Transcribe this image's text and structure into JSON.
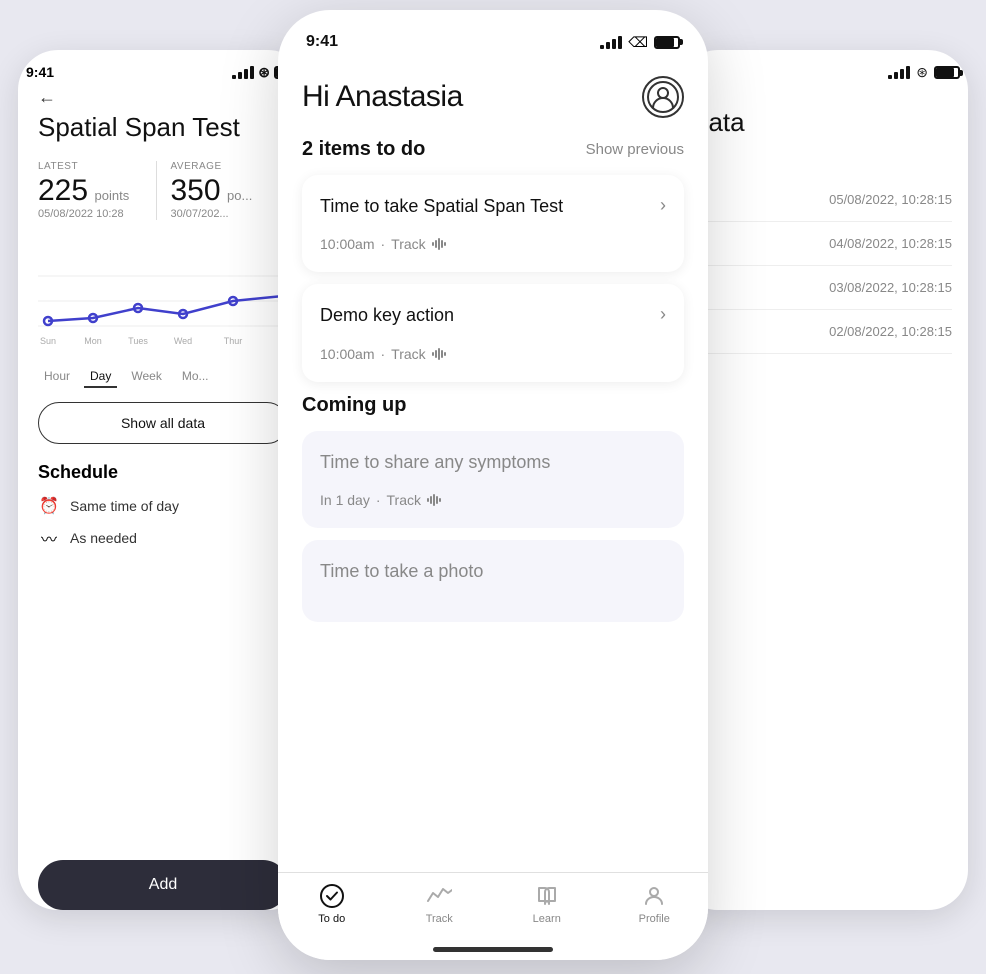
{
  "backLeftPhone": {
    "statusTime": "9:41",
    "backArrow": "←",
    "pageTitle": "Spatial Span Test",
    "stats": {
      "latest": {
        "label": "LATEST",
        "value": "225",
        "unit": "points",
        "date": "05/08/2022 10:28"
      },
      "average": {
        "label": "AVERAGE",
        "value": "350",
        "unit": "po...",
        "date": "30/07/202..."
      }
    },
    "chartDays": [
      "Sun",
      "Mon",
      "Tues",
      "Wed",
      "Thur"
    ],
    "timeTabs": [
      "Hour",
      "Day",
      "Week",
      "Mo..."
    ],
    "activeTab": "Day",
    "showDataBtn": "Show all data",
    "schedule": {
      "title": "Schedule",
      "items": [
        {
          "icon": "⏰",
          "text": "Same time of day"
        },
        {
          "icon": "〰",
          "text": "As needed"
        }
      ]
    },
    "addBtn": "Add"
  },
  "frontPhone": {
    "statusTime": "9:41",
    "greeting": "Hi Anastasia",
    "todoCount": "2 items to do",
    "showPrevious": "Show previous",
    "todoItems": [
      {
        "title": "Time to take Spatial Span Test",
        "time": "10:00am",
        "category": "Track",
        "hasChevron": true
      },
      {
        "title": "Demo key action",
        "time": "10:00am",
        "category": "Track",
        "hasChevron": true
      }
    ],
    "comingUpTitle": "Coming up",
    "comingUpItems": [
      {
        "title": "Time to share any symptoms",
        "time": "In 1 day",
        "category": "Track"
      },
      {
        "title": "Time to take a photo",
        "time": "",
        "category": ""
      }
    ],
    "bottomNav": [
      {
        "label": "To do",
        "icon": "check-circle",
        "active": true
      },
      {
        "label": "Track",
        "icon": "activity",
        "active": false
      },
      {
        "label": "Learn",
        "icon": "book",
        "active": false
      },
      {
        "label": "Profile",
        "icon": "user",
        "active": false
      }
    ]
  },
  "backRightPhone": {
    "dataRows": [
      "05/08/2022, 10:28:15",
      "04/08/2022, 10:28:15",
      "03/08/2022, 10:28:15",
      "02/08/2022, 10:28:15"
    ],
    "pageTitle": "data"
  }
}
